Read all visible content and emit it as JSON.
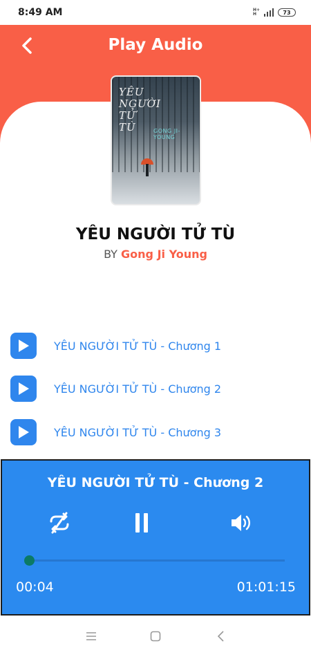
{
  "status_bar": {
    "time": "8:49 AM",
    "battery": "73",
    "icons": [
      "network-type-icon",
      "signal-icon",
      "battery-icon"
    ]
  },
  "header": {
    "title": "Play Audio",
    "back_icon": "chevron-left-icon",
    "color": "#f95f47"
  },
  "book": {
    "cover_title": "YÊU\nNGƯỜI\nTỬ\nTÙ",
    "cover_author": "GONG JI-YOUNG",
    "title": "YÊU NGƯỜI TỬ TÙ",
    "by_label": "BY",
    "author": "Gong Ji Young"
  },
  "chapters": [
    {
      "label": "YÊU NGƯỜI TỬ TÙ - Chương 1",
      "icon": "play-icon"
    },
    {
      "label": "YÊU NGƯỜI TỬ TÙ - Chương 2",
      "icon": "play-icon"
    },
    {
      "label": "YÊU NGƯỜI TỬ TÙ - Chương 3",
      "icon": "play-icon"
    }
  ],
  "player": {
    "now_playing": "YÊU NGƯỜI TỬ TÙ - Chương 2",
    "elapsed": "00:04",
    "duration": "01:01:15",
    "progress_fraction": 0.0011,
    "controls": [
      "repeat-off-icon",
      "pause-icon",
      "volume-icon"
    ],
    "background": "#2b8aef",
    "thumb_color": "#0b7a66"
  },
  "nav": {
    "buttons": [
      "menu-icon",
      "home-icon",
      "back-icon"
    ]
  }
}
